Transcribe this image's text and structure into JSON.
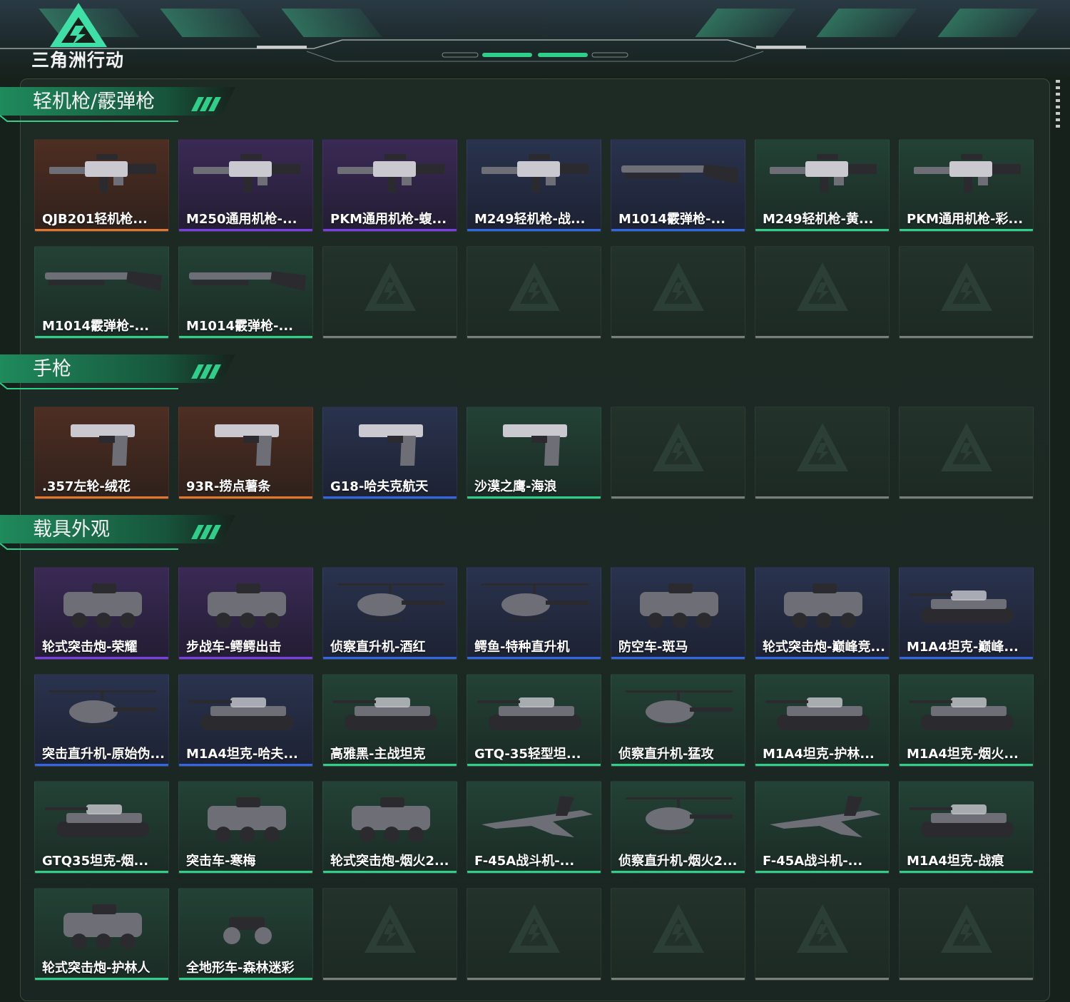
{
  "app": {
    "logo_text": "三角洲行动"
  },
  "rarity_colors": {
    "orange": "#e0772f",
    "purple": "#7a3fe0",
    "blue": "#2f68e0",
    "green": "#2fcf8a",
    "empty": "#7a7f7c"
  },
  "sections": [
    {
      "title": "轻机枪/霰弹枪",
      "slots": 14,
      "items": [
        {
          "label": "QJB201轻机枪...",
          "rarity": "orange",
          "icon": "light-machine-gun-icon"
        },
        {
          "label": "M250通用机枪-...",
          "rarity": "purple",
          "icon": "machine-gun-icon"
        },
        {
          "label": "PKM通用机枪-蝮...",
          "rarity": "purple",
          "icon": "machine-gun-icon"
        },
        {
          "label": "M249轻机枪-战...",
          "rarity": "blue",
          "icon": "light-machine-gun-icon"
        },
        {
          "label": "M1014霰弹枪-...",
          "rarity": "blue",
          "icon": "shotgun-icon"
        },
        {
          "label": "M249轻机枪-黄...",
          "rarity": "green",
          "icon": "light-machine-gun-icon"
        },
        {
          "label": "PKM通用机枪-彩...",
          "rarity": "green",
          "icon": "machine-gun-icon"
        },
        {
          "label": "M1014霰弹枪-...",
          "rarity": "green",
          "icon": "shotgun-icon"
        },
        {
          "label": "M1014霰弹枪-...",
          "rarity": "green",
          "icon": "shotgun-icon"
        }
      ]
    },
    {
      "title": "手枪",
      "slots": 7,
      "items": [
        {
          "label": ".357左轮-绒花",
          "rarity": "orange",
          "icon": "revolver-icon"
        },
        {
          "label": "93R-捞点薯条",
          "rarity": "orange",
          "icon": "pistol-icon"
        },
        {
          "label": "G18-哈夫克航天",
          "rarity": "blue",
          "icon": "pistol-icon"
        },
        {
          "label": "沙漠之鹰-海浪",
          "rarity": "green",
          "icon": "pistol-icon"
        }
      ]
    },
    {
      "title": "载具外观",
      "slots": 28,
      "items": [
        {
          "label": "轮式突击炮-荣耀",
          "rarity": "purple",
          "icon": "armored-car-icon"
        },
        {
          "label": "步战车-鳄鳄出击",
          "rarity": "purple",
          "icon": "ifv-icon"
        },
        {
          "label": "侦察直升机-酒红",
          "rarity": "blue",
          "icon": "helicopter-icon"
        },
        {
          "label": "鳄鱼-特种直升机",
          "rarity": "blue",
          "icon": "helicopter-icon"
        },
        {
          "label": "防空车-斑马",
          "rarity": "blue",
          "icon": "ifv-icon"
        },
        {
          "label": "轮式突击炮-巅峰竞...",
          "rarity": "blue",
          "icon": "armored-car-icon"
        },
        {
          "label": "M1A4坦克-巅峰...",
          "rarity": "blue",
          "icon": "tank-icon"
        },
        {
          "label": "突击直升机-原始伪...",
          "rarity": "blue",
          "icon": "helicopter-icon"
        },
        {
          "label": "M1A4坦克-哈夫...",
          "rarity": "blue",
          "icon": "tank-icon"
        },
        {
          "label": "高雅黑-主战坦克",
          "rarity": "green",
          "icon": "tank-icon"
        },
        {
          "label": "GTQ-35轻型坦...",
          "rarity": "green",
          "icon": "tank-icon"
        },
        {
          "label": "侦察直升机-猛攻",
          "rarity": "green",
          "icon": "helicopter-icon"
        },
        {
          "label": "M1A4坦克-护林...",
          "rarity": "green",
          "icon": "tank-icon"
        },
        {
          "label": "M1A4坦克-烟火...",
          "rarity": "green",
          "icon": "tank-icon"
        },
        {
          "label": "GTQ35坦克-烟...",
          "rarity": "green",
          "icon": "tank-icon"
        },
        {
          "label": "突击车-寒梅",
          "rarity": "green",
          "icon": "armored-car-icon"
        },
        {
          "label": "轮式突击炮-烟火2...",
          "rarity": "green",
          "icon": "armored-car-icon"
        },
        {
          "label": "F-45A战斗机-...",
          "rarity": "green",
          "icon": "fighter-jet-icon"
        },
        {
          "label": "侦察直升机-烟火2...",
          "rarity": "green",
          "icon": "helicopter-icon"
        },
        {
          "label": "F-45A战斗机-...",
          "rarity": "green",
          "icon": "fighter-jet-icon"
        },
        {
          "label": "M1A4坦克-战痕",
          "rarity": "green",
          "icon": "tank-icon"
        },
        {
          "label": "轮式突击炮-护林人",
          "rarity": "green",
          "icon": "armored-car-icon"
        },
        {
          "label": "全地形车-森林迷彩",
          "rarity": "green",
          "icon": "atv-icon"
        }
      ]
    }
  ]
}
